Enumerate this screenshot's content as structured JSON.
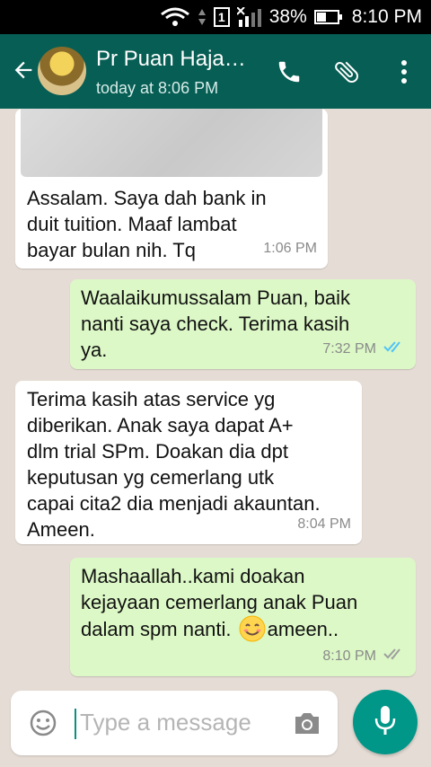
{
  "status_bar": {
    "sim_label": "1",
    "battery": "38%",
    "time": "8:10 PM"
  },
  "header": {
    "contact_name": "Pr Puan Haja…",
    "last_seen": "today at 8:06 PM",
    "icons": [
      "back-arrow-icon",
      "call-icon",
      "attach-icon",
      "more-vert-icon"
    ],
    "color": "#075e54"
  },
  "messages": [
    {
      "dir": "in",
      "has_image": true,
      "text": "Assalam. Saya dah bank in\nduit tuition. Maaf lambat\nbayar bulan nih. Tq",
      "time": "1:06 PM"
    },
    {
      "dir": "out",
      "text": "Waalaikumussalam Puan, baik\nnanti saya check. Terima kasih\nya.",
      "time": "7:32 PM",
      "ticks": "read"
    },
    {
      "dir": "in",
      "text": "Terima kasih atas service yg\ndiberikan. Anak saya dapat A+\ndlm trial SPm. Doakan dia dpt\nkeputusan yg cemerlang utk\ncapai cita2 dia menjadi akauntan.\nAmeen.",
      "time": "8:04 PM"
    },
    {
      "dir": "out",
      "text_line1": "Mashaallah..kami doakan",
      "text_line2": "kejayaan cemerlang anak Puan",
      "text_line3_a": "dalam spm nanti. ",
      "text_line3_b": "ameen..",
      "time": "8:10 PM",
      "ticks": "delivered"
    }
  ],
  "composer": {
    "placeholder": "Type a message"
  },
  "colors": {
    "incoming": "#ffffff",
    "outgoing": "#dcf8c6",
    "fab": "#009688",
    "read_tick": "#4fc3f7"
  }
}
